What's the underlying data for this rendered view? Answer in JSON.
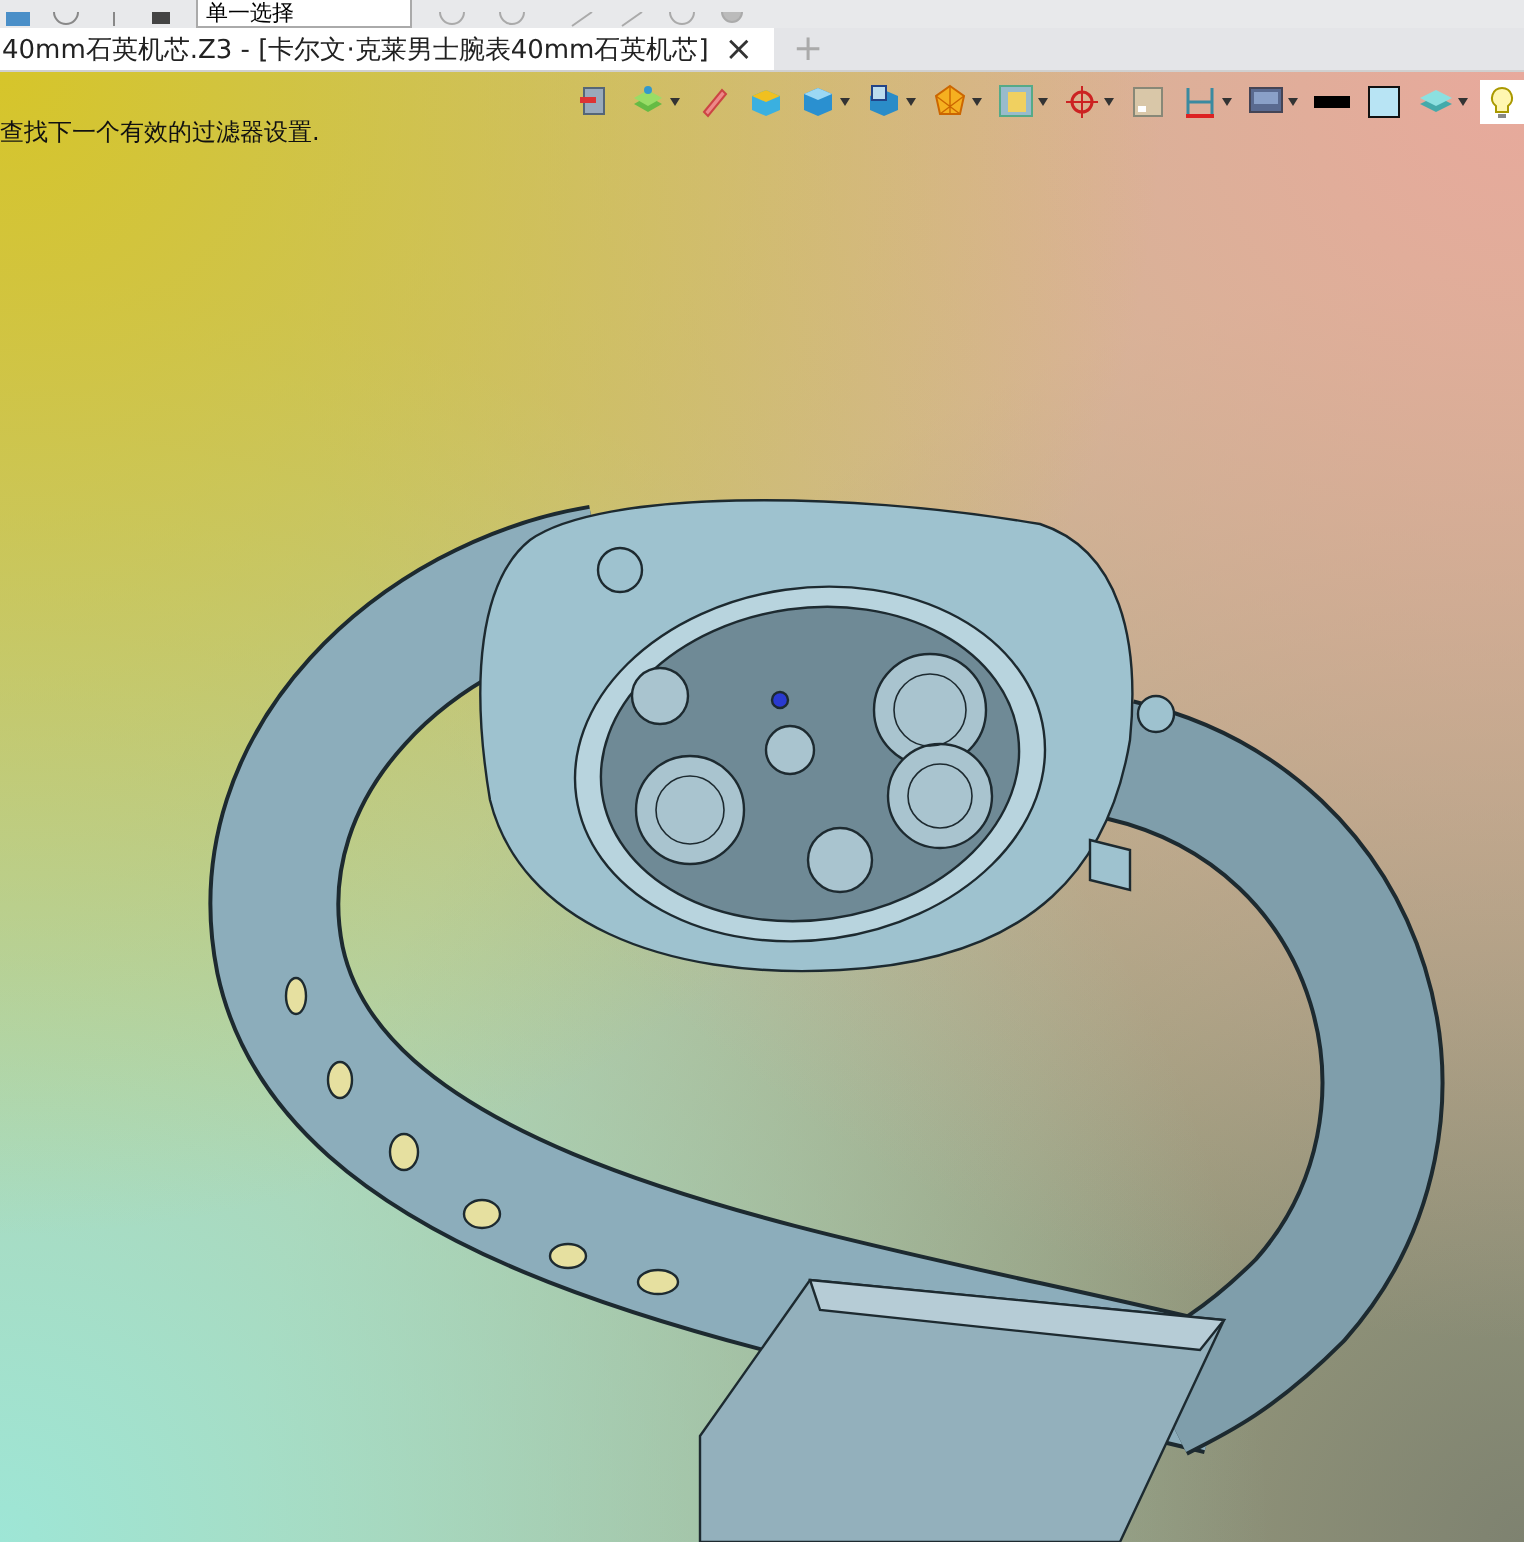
{
  "top_toolbar": {
    "selection_filter": "单一选择"
  },
  "tabs": [
    {
      "title": "40mm石英机芯.Z3 - [卡尔文·克莱男士腕表40mm石英机芯]",
      "close": "×",
      "selected": true
    }
  ],
  "new_tab": "+",
  "viewport": {
    "hint": "查找下一个有效的过滤器设置.",
    "view_toolbar": [
      {
        "kind": "exit",
        "dropdown": false,
        "selected": false
      },
      {
        "kind": "layers",
        "dropdown": true,
        "selected": false
      },
      {
        "kind": "pen",
        "dropdown": false,
        "selected": false
      },
      {
        "kind": "box",
        "dropdown": false,
        "selected": false
      },
      {
        "kind": "cube",
        "dropdown": true,
        "selected": false
      },
      {
        "kind": "view",
        "dropdown": true,
        "selected": false
      },
      {
        "kind": "polygon",
        "dropdown": true,
        "selected": false
      },
      {
        "kind": "frame",
        "dropdown": true,
        "selected": false
      },
      {
        "kind": "target",
        "dropdown": true,
        "selected": false
      },
      {
        "kind": "window",
        "dropdown": false,
        "selected": false
      },
      {
        "kind": "dimension",
        "dropdown": true,
        "selected": false
      },
      {
        "kind": "monitor",
        "dropdown": true,
        "selected": false
      },
      {
        "kind": "line",
        "dropdown": false,
        "selected": false
      },
      {
        "kind": "fill",
        "dropdown": false,
        "selected": false
      },
      {
        "kind": "stack",
        "dropdown": true,
        "selected": false
      },
      {
        "kind": "light",
        "dropdown": false,
        "selected": true
      }
    ]
  }
}
